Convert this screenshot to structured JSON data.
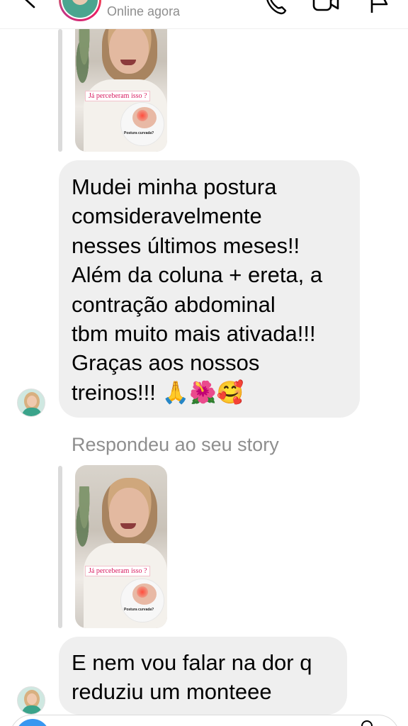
{
  "header": {
    "status": "Online agora"
  },
  "messages": [
    {
      "type": "story_reply",
      "story_caption": "Já perceberam isso ?",
      "story_inset_label": "Postura curvada?"
    },
    {
      "type": "text",
      "lines": [
        "Mudei minha postura",
        "comsideravelmente",
        "nesses últimos meses!!",
        "Além da coluna + ereta, a",
        "contração abdominal",
        "tbm muito mais ativada!!!",
        "Graças aos nossos",
        "treinos!!! 🙏🌺🥰"
      ]
    },
    {
      "type": "reply_label",
      "text": "Respondeu ao seu story"
    },
    {
      "type": "story_reply",
      "story_caption": "Já perceberam isso ?",
      "story_inset_label": "Postura curvada?"
    },
    {
      "type": "text",
      "lines": [
        "E nem vou falar na dor q",
        "reduziu um monteee"
      ]
    }
  ],
  "colors": {
    "bubble": "#efefef",
    "meta_text": "#8e8e8e",
    "accent": "#3897f0",
    "caption_pink": "#d81b60"
  },
  "icons": [
    "back-icon",
    "call-icon",
    "video-icon",
    "flag-icon",
    "camera-icon"
  ]
}
